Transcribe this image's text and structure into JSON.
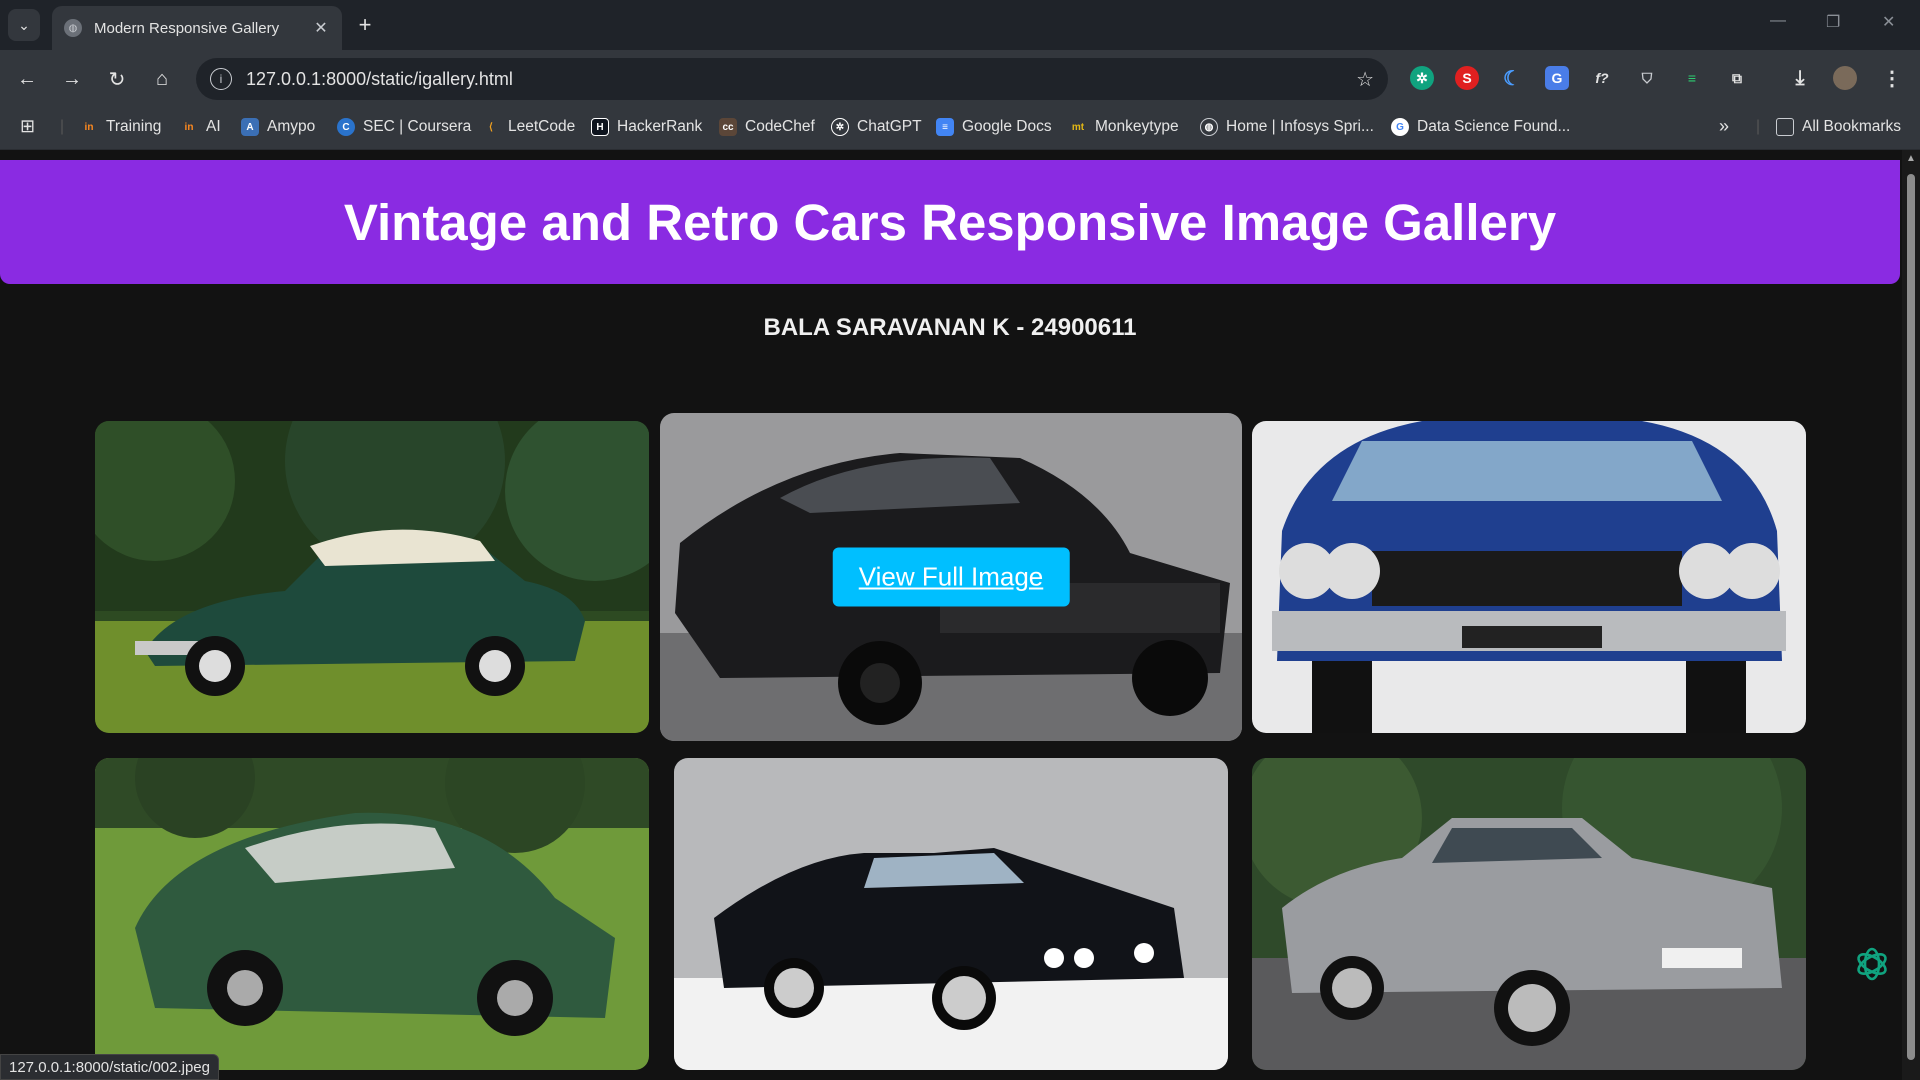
{
  "browser": {
    "tab_title": "Modern Responsive Gallery",
    "tab_close": "✕",
    "new_tab": "+",
    "url": "127.0.0.1:8000/static/igallery.html",
    "status_url": "127.0.0.1:8000/static/002.jpeg",
    "bookmarks": [
      {
        "label": "Training",
        "icon": "training-icon"
      },
      {
        "label": "AI",
        "icon": "ai-icon"
      },
      {
        "label": "Amypo",
        "icon": "amypo-icon"
      },
      {
        "label": "SEC | Coursera",
        "icon": "coursera-icon"
      },
      {
        "label": "LeetCode",
        "icon": "leetcode-icon"
      },
      {
        "label": "HackerRank",
        "icon": "hackerrank-icon"
      },
      {
        "label": "CodeChef",
        "icon": "codechef-icon"
      },
      {
        "label": "ChatGPT",
        "icon": "chatgpt-icon"
      },
      {
        "label": "Google Docs",
        "icon": "google-docs-icon"
      },
      {
        "label": "Monkeytype",
        "icon": "monkeytype-icon"
      },
      {
        "label": "Home | Infosys Spri...",
        "icon": "globe-icon"
      },
      {
        "label": "Data Science Found...",
        "icon": "google-icon"
      }
    ],
    "all_bookmarks": "All Bookmarks"
  },
  "page": {
    "title": "Vintage and Retro Cars Responsive Image Gallery",
    "subtitle": "BALA SARAVANAN K - 24900611",
    "view_button": "View Full Image",
    "gallery": [
      {
        "name": "green-vintage-sedan",
        "car_color": "#1e4a3c"
      },
      {
        "name": "black-muscle-car",
        "car_color": "#1b1b1d"
      },
      {
        "name": "blue-muscle-car-front",
        "car_color": "#1f3f8f"
      },
      {
        "name": "green-porsche-coupe",
        "car_color": "#2f5a3e"
      },
      {
        "name": "black-bmw-coupe",
        "car_color": "#111318"
      },
      {
        "name": "silver-bmw-sedan",
        "car_color": "#9a9ca0"
      }
    ]
  },
  "colors": {
    "header_bg": "#8a2be2",
    "button_bg": "#00bfff",
    "page_bg": "#121212"
  }
}
